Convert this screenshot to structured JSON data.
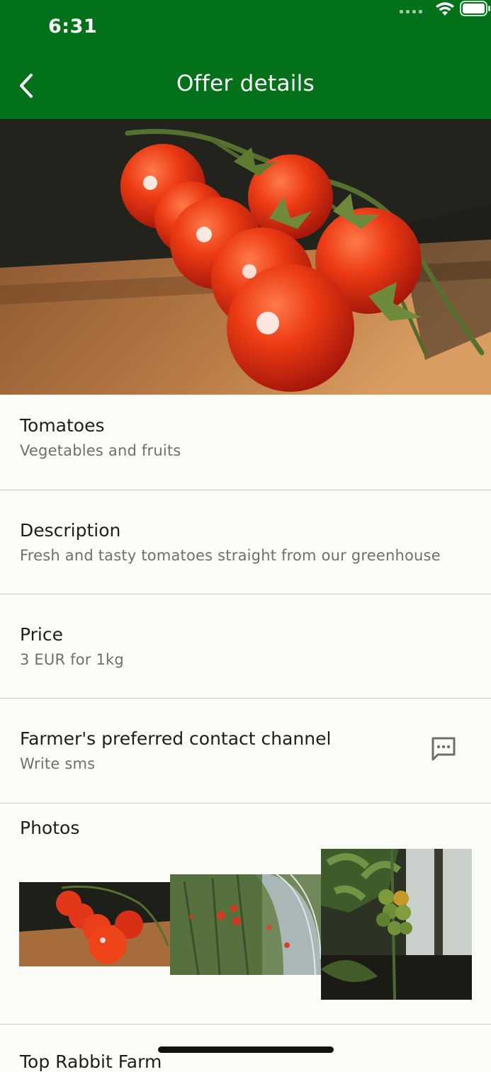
{
  "status_bar": {
    "time": "6:31"
  },
  "header": {
    "title": "Offer details",
    "back_icon": "chevron-left-icon"
  },
  "colors": {
    "primary": "#03701a",
    "background": "#fcfcf7",
    "divider": "#c9c9c4",
    "secondary_text": "#6f6f6c"
  },
  "offer": {
    "name": "Tomatoes",
    "category": "Vegetables and fruits",
    "description_label": "Description",
    "description": "Fresh and tasty tomatoes straight from our greenhouse",
    "price_label": "Price",
    "price": "3 EUR for 1kg",
    "contact_label": "Farmer's preferred contact channel",
    "contact": "Write sms",
    "contact_icon": "sms-icon"
  },
  "photos": {
    "label": "Photos",
    "items": [
      "tomato-vine-photo",
      "greenhouse-tomatoes-photo",
      "green-tomatoes-photo"
    ]
  },
  "farm": {
    "name": "Top Rabbit Farm"
  }
}
